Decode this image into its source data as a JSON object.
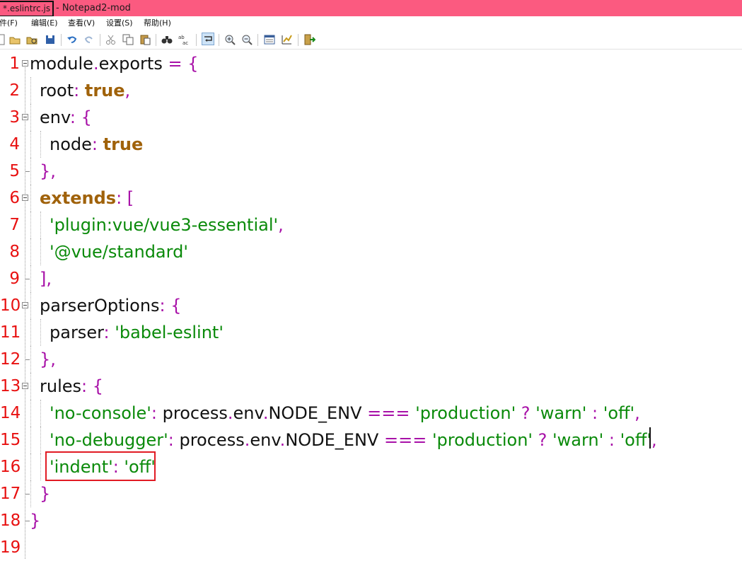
{
  "window": {
    "file_tab": "*.eslintrc.js",
    "title_rest": "- Notepad2-mod"
  },
  "menu": [
    "文件(F)",
    "编辑(E)",
    "查看(V)",
    "设置(S)",
    "帮助(H)"
  ],
  "toolbar": [
    {
      "name": "new-icon"
    },
    {
      "name": "open-icon"
    },
    {
      "name": "browse-icon"
    },
    {
      "name": "save-icon"
    },
    {
      "name": "undo-icon"
    },
    {
      "name": "redo-icon"
    },
    {
      "name": "cut-icon"
    },
    {
      "name": "copy-icon"
    },
    {
      "name": "paste-icon"
    },
    {
      "name": "find-icon"
    },
    {
      "name": "replace-icon"
    },
    {
      "name": "word-wrap-icon"
    },
    {
      "name": "zoom-in-icon"
    },
    {
      "name": "zoom-out-icon"
    },
    {
      "name": "scheme-icon"
    },
    {
      "name": "customize-icon"
    },
    {
      "name": "exit-icon"
    }
  ],
  "colors": {
    "titlebar": "#fb5a80",
    "line_numbers": "#e81010",
    "punctuation": "#a811a8",
    "string": "#0a8a0a",
    "keyword": "#a0620a",
    "highlight_box": "#e11b24"
  },
  "editor": {
    "line_numbers": [
      "1",
      "2",
      "3",
      "4",
      "5",
      "6",
      "7",
      "8",
      "9",
      "10",
      "11",
      "12",
      "13",
      "14",
      "15",
      "16",
      "17",
      "18",
      "19"
    ],
    "lines": [
      [
        [
          "t",
          "module"
        ],
        [
          "p",
          "."
        ],
        [
          "t",
          "exports "
        ],
        [
          "p",
          "= {"
        ]
      ],
      [
        [
          "t",
          "root"
        ],
        [
          "p",
          ": "
        ],
        [
          "k",
          "true"
        ],
        [
          "p",
          ","
        ]
      ],
      [
        [
          "t",
          "env"
        ],
        [
          "p",
          ": {"
        ]
      ],
      [
        [
          "t",
          "node"
        ],
        [
          "p",
          ": "
        ],
        [
          "k",
          "true"
        ]
      ],
      [
        [
          "p",
          "},"
        ]
      ],
      [
        [
          "k",
          "extends"
        ],
        [
          "p",
          ": ["
        ]
      ],
      [
        [
          "s",
          "'plugin:vue/vue3-essential'"
        ],
        [
          "p",
          ","
        ]
      ],
      [
        [
          "s",
          "'@vue/standard'"
        ]
      ],
      [
        [
          "p",
          "],"
        ]
      ],
      [
        [
          "t",
          "parserOptions"
        ],
        [
          "p",
          ": {"
        ]
      ],
      [
        [
          "t",
          "parser"
        ],
        [
          "p",
          ": "
        ],
        [
          "s",
          "'babel-eslint'"
        ]
      ],
      [
        [
          "p",
          "},"
        ]
      ],
      [
        [
          "t",
          "rules"
        ],
        [
          "p",
          ": {"
        ]
      ],
      [
        [
          "s",
          "'no-console'"
        ],
        [
          "p",
          ": "
        ],
        [
          "t",
          "process"
        ],
        [
          "p",
          "."
        ],
        [
          "t",
          "env"
        ],
        [
          "p",
          "."
        ],
        [
          "t",
          "NODE_ENV "
        ],
        [
          "p",
          "=== "
        ],
        [
          "s",
          "'production' "
        ],
        [
          "p",
          "? "
        ],
        [
          "s",
          "'warn' "
        ],
        [
          "p",
          ": "
        ],
        [
          "s",
          "'off'"
        ],
        [
          "p",
          ","
        ]
      ],
      [
        [
          "s",
          "'no-debugger'"
        ],
        [
          "p",
          ": "
        ],
        [
          "t",
          "process"
        ],
        [
          "p",
          "."
        ],
        [
          "t",
          "env"
        ],
        [
          "p",
          "."
        ],
        [
          "t",
          "NODE_ENV "
        ],
        [
          "p",
          "=== "
        ],
        [
          "s",
          "'production' "
        ],
        [
          "p",
          "? "
        ],
        [
          "s",
          "'warn' "
        ],
        [
          "p",
          ": "
        ],
        [
          "s",
          "'off'"
        ],
        [
          "p",
          ","
        ]
      ],
      [
        [
          "s",
          "'indent'"
        ],
        [
          "p",
          ": "
        ],
        [
          "s",
          "'off'"
        ]
      ],
      [
        [
          "p",
          "}"
        ]
      ],
      [
        [
          "p",
          "}"
        ]
      ],
      []
    ]
  }
}
